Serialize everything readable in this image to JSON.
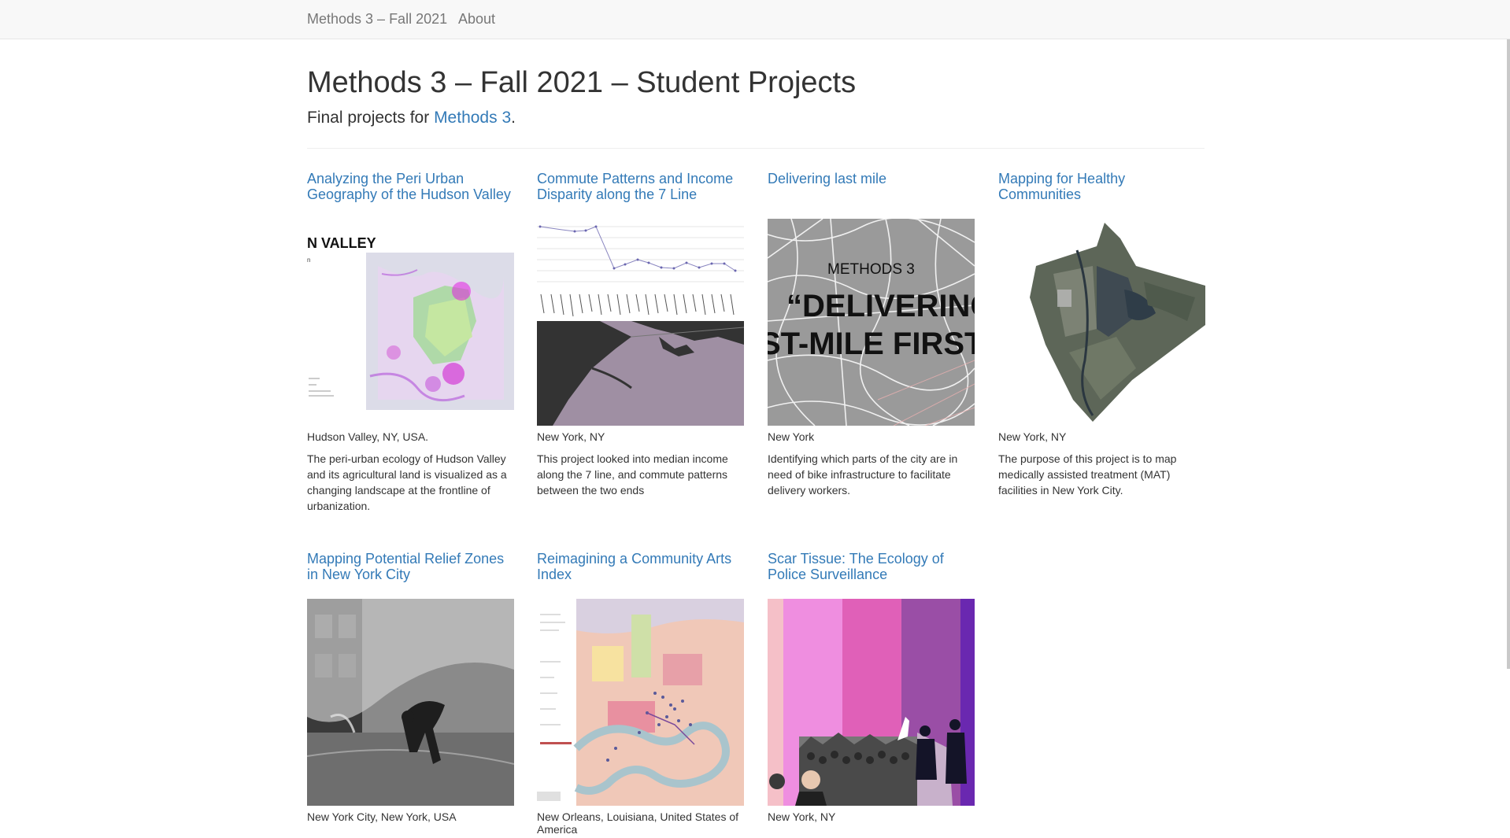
{
  "nav": {
    "brand": "Methods 3 – Fall 2021",
    "about": "About"
  },
  "header": {
    "title": "Methods 3 – Fall 2021 – Student Projects",
    "subtitle_prefix": "Final projects for ",
    "subtitle_link": "Methods 3",
    "subtitle_suffix": "."
  },
  "projects": [
    {
      "title": "Analyzing the Peri Urban Geography of the Hudson Valley",
      "location": "Hudson Valley, NY, USA.",
      "description": "The peri-urban ecology of Hudson Valley and its agricultural land is visualized as a changing landscape at the frontline of urbanization.",
      "image_text": "N VALLEY"
    },
    {
      "title": "Commute Patterns and Income Disparity along the 7 Line",
      "location": "New York, NY",
      "description": "This project looked into median income along the 7 line, and commute patterns between the two ends",
      "image_text": ""
    },
    {
      "title": "Delivering last mile",
      "location": "New York",
      "description": "Identifying which parts of the city are in need of bike infrastructure to facilitate delivery workers.",
      "image_text_1": "METHODS 3",
      "image_text_2": "“DELIVERING",
      "image_text_3": "ST-MILE FIRST"
    },
    {
      "title": "Mapping for Healthy Communities",
      "location": "New York, NY",
      "description": "The purpose of this project is to map medically assisted treatment (MAT) facilities in New York City.",
      "image_text": ""
    },
    {
      "title": "Mapping Potential Relief Zones in New York City",
      "location": "New York City, New York, USA",
      "description": "",
      "image_text": ""
    },
    {
      "title": "Reimagining a Community Arts Index",
      "location": "New Orleans, Louisiana, United States of America",
      "description": "",
      "image_text": ""
    },
    {
      "title": "Scar Tissue: The Ecology of Police Surveillance",
      "location": "New York, NY",
      "description": "",
      "image_text": ""
    }
  ],
  "colors": {
    "link": "#337ab7",
    "navbar_bg": "#f8f8f8",
    "text": "#333333"
  }
}
